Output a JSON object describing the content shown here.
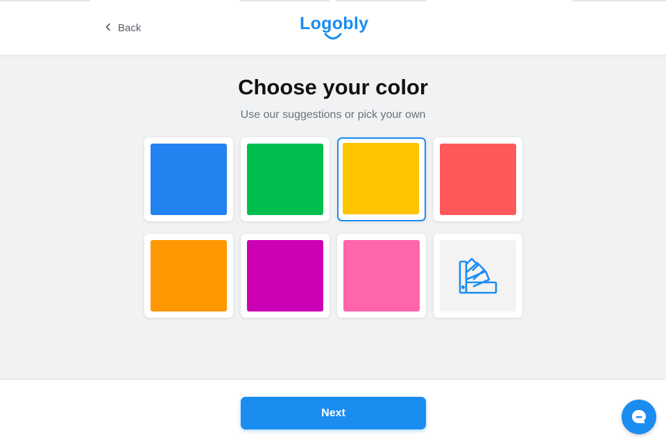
{
  "header": {
    "back_label": "Back",
    "logo_text": "Logobly",
    "brand_color": "#1b8cf0"
  },
  "main": {
    "title": "Choose your color",
    "subtitle": "Use our suggestions or pick your own",
    "swatches": [
      {
        "name": "blue",
        "color": "#2183f0",
        "selected": false
      },
      {
        "name": "green",
        "color": "#00bf4f",
        "selected": false
      },
      {
        "name": "yellow",
        "color": "#ffc400",
        "selected": true
      },
      {
        "name": "red",
        "color": "#ff585a",
        "selected": false
      },
      {
        "name": "orange",
        "color": "#ff9800",
        "selected": false
      },
      {
        "name": "purple",
        "color": "#cc00b5",
        "selected": false
      },
      {
        "name": "pink",
        "color": "#ff65aa",
        "selected": false
      }
    ],
    "custom_picker_icon": "color-palette-fan-icon"
  },
  "footer": {
    "next_label": "Next",
    "chat_icon": "chat-bubble-icon"
  }
}
